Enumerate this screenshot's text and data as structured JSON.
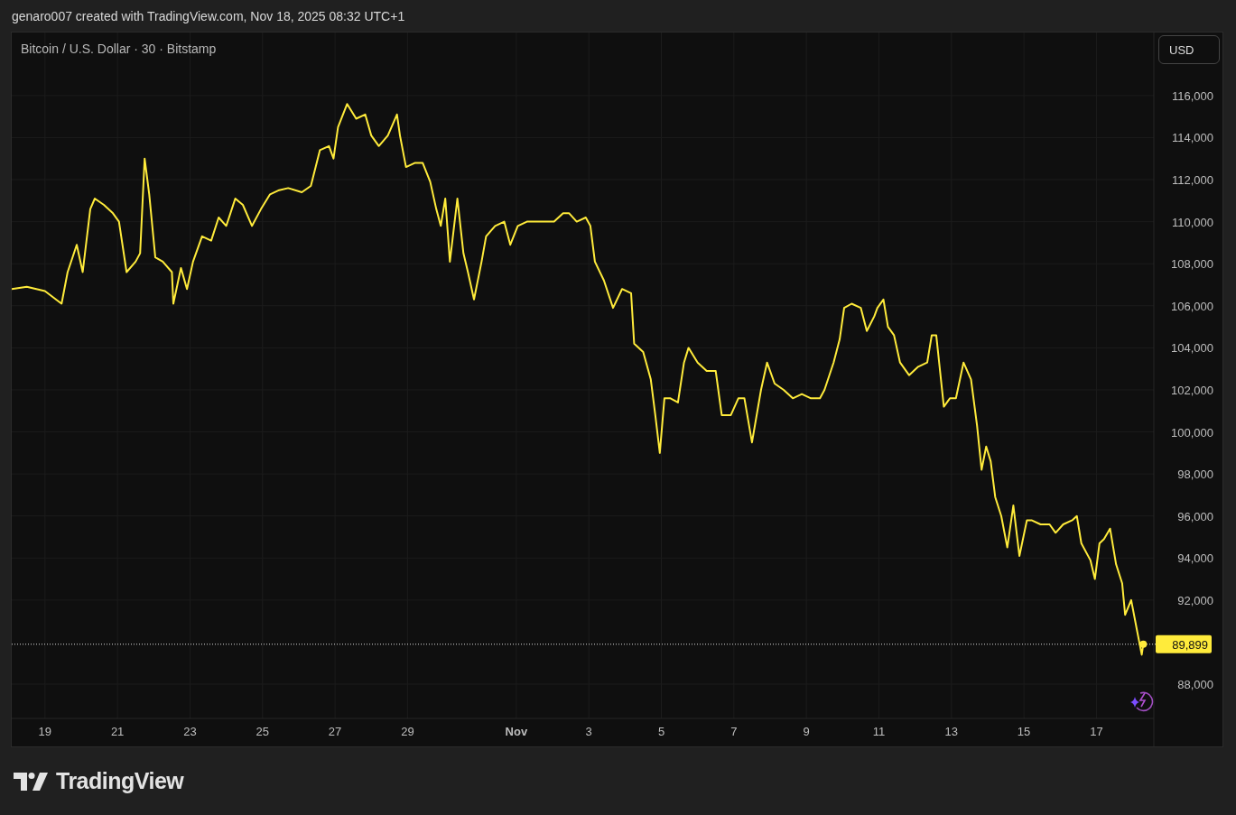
{
  "attribution": "genaro007 created with TradingView.com, Nov 18, 2025 08:32 UTC+1",
  "chart": {
    "symbol_title": "Bitcoin / U.S. Dollar · 30 · Bitstamp",
    "currency_button": "USD",
    "chart_data": {
      "type": "line",
      "grid": true,
      "xlim": [
        "2025-10-18T02:00",
        "2025-11-18T14:00"
      ],
      "ylim": [
        86370,
        119000
      ],
      "xticks": [
        {
          "value": "2025-10-19T00:00",
          "label": "19"
        },
        {
          "value": "2025-10-21T00:00",
          "label": "21"
        },
        {
          "value": "2025-10-23T00:00",
          "label": "23"
        },
        {
          "value": "2025-10-25T00:00",
          "label": "25"
        },
        {
          "value": "2025-10-27T00:00",
          "label": "27"
        },
        {
          "value": "2025-10-29T00:00",
          "label": "29"
        },
        {
          "value": "2025-11-01T00:00",
          "label": "Nov"
        },
        {
          "value": "2025-11-03T00:00",
          "label": "3"
        },
        {
          "value": "2025-11-05T00:00",
          "label": "5"
        },
        {
          "value": "2025-11-07T00:00",
          "label": "7"
        },
        {
          "value": "2025-11-09T00:00",
          "label": "9"
        },
        {
          "value": "2025-11-11T00:00",
          "label": "11"
        },
        {
          "value": "2025-11-13T00:00",
          "label": "13"
        },
        {
          "value": "2025-11-15T00:00",
          "label": "15"
        },
        {
          "value": "2025-11-17T00:00",
          "label": "17"
        }
      ],
      "yticks": [
        {
          "value": 88000,
          "label": "88,000"
        },
        {
          "value": 92000,
          "label": "92,000"
        },
        {
          "value": 94000,
          "label": "94,000"
        },
        {
          "value": 96000,
          "label": "96,000"
        },
        {
          "value": 98000,
          "label": "98,000"
        },
        {
          "value": 100000,
          "label": "100,000"
        },
        {
          "value": 102000,
          "label": "102,000"
        },
        {
          "value": 104000,
          "label": "104,000"
        },
        {
          "value": 106000,
          "label": "106,000"
        },
        {
          "value": 108000,
          "label": "108,000"
        },
        {
          "value": 110000,
          "label": "110,000"
        },
        {
          "value": 112000,
          "label": "112,000"
        },
        {
          "value": 114000,
          "label": "114,000"
        },
        {
          "value": 116000,
          "label": "116,000"
        }
      ],
      "x": [
        "2025-10-18T02:00",
        "2025-10-18T12:00",
        "2025-10-19T00:00",
        "2025-10-19T11:00",
        "2025-10-19T15:00",
        "2025-10-19T21:00",
        "2025-10-20T01:00",
        "2025-10-20T06:00",
        "2025-10-20T09:00",
        "2025-10-20T15:00",
        "2025-10-20T21:00",
        "2025-10-21T01:00",
        "2025-10-21T06:00",
        "2025-10-21T12:00",
        "2025-10-21T15:00",
        "2025-10-21T18:00",
        "2025-10-21T21:00",
        "2025-10-22T01:00",
        "2025-10-22T06:00",
        "2025-10-22T12:00",
        "2025-10-22T13:00",
        "2025-10-22T18:00",
        "2025-10-22T22:00",
        "2025-10-23T02:00",
        "2025-10-23T08:00",
        "2025-10-23T14:00",
        "2025-10-23T19:00",
        "2025-10-24T00:00",
        "2025-10-24T06:00",
        "2025-10-24T11:00",
        "2025-10-24T17:00",
        "2025-10-24T23:00",
        "2025-10-25T05:00",
        "2025-10-25T11:00",
        "2025-10-25T17:00",
        "2025-10-26T02:00",
        "2025-10-26T08:00",
        "2025-10-26T14:00",
        "2025-10-26T20:00",
        "2025-10-26T23:00",
        "2025-10-27T02:00",
        "2025-10-27T08:00",
        "2025-10-27T14:00",
        "2025-10-27T20:00",
        "2025-10-28T00:00",
        "2025-10-28T05:00",
        "2025-10-28T11:00",
        "2025-10-28T17:00",
        "2025-10-28T19:00",
        "2025-10-28T23:00",
        "2025-10-29T05:00",
        "2025-10-29T10:00",
        "2025-10-29T15:00",
        "2025-10-29T19:00",
        "2025-10-29T22:00",
        "2025-10-30T01:00",
        "2025-10-30T04:00",
        "2025-10-30T09:00",
        "2025-10-30T13:00",
        "2025-10-30T16:00",
        "2025-10-30T20:00",
        "2025-10-31T01:00",
        "2025-10-31T04:00",
        "2025-10-31T10:00",
        "2025-10-31T16:00",
        "2025-10-31T20:00",
        "2025-11-01T01:00",
        "2025-11-01T07:00",
        "2025-11-01T16:00",
        "2025-11-02T01:00",
        "2025-11-02T07:00",
        "2025-11-02T11:00",
        "2025-11-02T16:00",
        "2025-11-02T22:00",
        "2025-11-03T01:00",
        "2025-11-03T04:00",
        "2025-11-03T10:00",
        "2025-11-03T16:00",
        "2025-11-03T22:00",
        "2025-11-04T04:00",
        "2025-11-04T06:00",
        "2025-11-04T12:00",
        "2025-11-04T17:00",
        "2025-11-04T20:00",
        "2025-11-04T23:00",
        "2025-11-05T02:00",
        "2025-11-05T06:00",
        "2025-11-05T11:00",
        "2025-11-05T15:00",
        "2025-11-05T18:00",
        "2025-11-06T00:00",
        "2025-11-06T06:00",
        "2025-11-06T12:00",
        "2025-11-06T16:00",
        "2025-11-06T22:00",
        "2025-11-07T03:00",
        "2025-11-07T07:00",
        "2025-11-07T12:00",
        "2025-11-07T18:00",
        "2025-11-07T22:00",
        "2025-11-08T03:00",
        "2025-11-08T09:00",
        "2025-11-08T15:00",
        "2025-11-08T21:00",
        "2025-11-09T03:00",
        "2025-11-09T09:00",
        "2025-11-09T12:00",
        "2025-11-09T18:00",
        "2025-11-09T22:00",
        "2025-11-10T01:00",
        "2025-11-10T06:00",
        "2025-11-10T12:00",
        "2025-11-10T16:00",
        "2025-11-10T21:00",
        "2025-11-10T23:00",
        "2025-11-11T03:00",
        "2025-11-11T06:00",
        "2025-11-11T10:00",
        "2025-11-11T14:00",
        "2025-11-11T20:00",
        "2025-11-12T02:00",
        "2025-11-12T08:00",
        "2025-11-12T11:00",
        "2025-11-12T14:00",
        "2025-11-12T19:00",
        "2025-11-12T23:00",
        "2025-11-13T03:00",
        "2025-11-13T08:00",
        "2025-11-13T13:00",
        "2025-11-13T17:00",
        "2025-11-13T20:00",
        "2025-11-13T23:00",
        "2025-11-14T02:00",
        "2025-11-14T05:00",
        "2025-11-14T09:00",
        "2025-11-14T13:00",
        "2025-11-14T17:00",
        "2025-11-14T21:00",
        "2025-11-15T02:00",
        "2025-11-15T05:00",
        "2025-11-15T11:00",
        "2025-11-15T17:00",
        "2025-11-15T21:00",
        "2025-11-16T02:00",
        "2025-11-16T08:00",
        "2025-11-16T11:00",
        "2025-11-16T14:00",
        "2025-11-16T20:00",
        "2025-11-16T23:00",
        "2025-11-17T02:00",
        "2025-11-17T05:00",
        "2025-11-17T09:00",
        "2025-11-17T13:00",
        "2025-11-17T17:00",
        "2025-11-17T19:00",
        "2025-11-17T23:00",
        "2025-11-18T03:00",
        "2025-11-18T06:00",
        "2025-11-18T07:00"
      ],
      "series": [
        {
          "color": "#ffeb3b",
          "values": [
            106800,
            106900,
            106700,
            106100,
            107600,
            108900,
            107600,
            110600,
            111100,
            110800,
            110400,
            110000,
            107600,
            108100,
            108500,
            113000,
            111300,
            108300,
            108100,
            107600,
            106100,
            107800,
            106800,
            108100,
            109300,
            109100,
            110200,
            109800,
            111100,
            110800,
            109800,
            110600,
            111300,
            111500,
            111600,
            111400,
            111700,
            113400,
            113600,
            113000,
            114500,
            115600,
            114900,
            115100,
            114100,
            113600,
            114100,
            115100,
            114100,
            112600,
            112800,
            112800,
            111900,
            110600,
            109800,
            111100,
            108100,
            111100,
            108500,
            107600,
            106300,
            108100,
            109300,
            109800,
            110000,
            108900,
            109800,
            110000,
            110000,
            110000,
            110400,
            110400,
            110000,
            110200,
            109800,
            108100,
            107200,
            105900,
            106800,
            106600,
            104200,
            103800,
            102500,
            100800,
            99000,
            101600,
            101600,
            101400,
            103300,
            104000,
            103300,
            102900,
            102900,
            100800,
            100800,
            101600,
            101600,
            99500,
            102000,
            103300,
            102300,
            102000,
            101600,
            101800,
            101600,
            101600,
            102000,
            103300,
            104400,
            105900,
            106100,
            105900,
            104800,
            105500,
            105900,
            106300,
            105000,
            104600,
            103300,
            102700,
            103100,
            103300,
            104600,
            104600,
            101200,
            101600,
            101600,
            103300,
            102500,
            100300,
            98200,
            99300,
            98600,
            96900,
            96000,
            94500,
            96500,
            94100,
            95800,
            95800,
            95600,
            95600,
            95200,
            95600,
            95800,
            96000,
            94700,
            93900,
            93000,
            94700,
            94900,
            95400,
            93700,
            92800,
            91300,
            92000,
            90500,
            89400,
            89900
          ]
        }
      ],
      "ref_lines": [
        {
          "axis": "y",
          "value": 89899,
          "label": "89,899"
        }
      ]
    }
  },
  "brand": "TradingView"
}
